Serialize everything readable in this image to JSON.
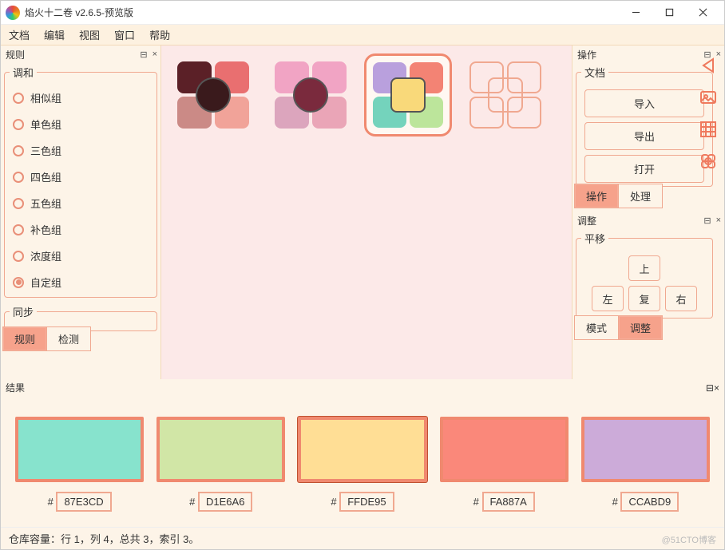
{
  "window": {
    "title": "焰火十二卷 v2.6.5-预览版"
  },
  "menu": [
    "文档",
    "编辑",
    "视图",
    "窗口",
    "帮助"
  ],
  "rules_panel": {
    "title": "规则",
    "group_label": "调和",
    "items": [
      "相似组",
      "单色组",
      "三色组",
      "四色组",
      "五色组",
      "补色组",
      "浓度组",
      "自定组"
    ],
    "selected_index": 7,
    "sync_label": "同步",
    "tabs": {
      "items": [
        "规则",
        "检测"
      ],
      "active": 0
    }
  },
  "palettes": {
    "selected_index": 2,
    "items": [
      {
        "colors": [
          "#5b2027",
          "#e96f70",
          "#cb8a86",
          "#f1a399"
        ],
        "center": "#3a1a1c",
        "center_round": true
      },
      {
        "colors": [
          "#f1a4c4",
          "#f1a4c4",
          "#dca5bd",
          "#eaa5b7"
        ],
        "center": "#7a2a3d",
        "center_round": true
      },
      {
        "colors": [
          "#b9a0dd",
          "#f38374",
          "#74d3bc",
          "#bce59b"
        ],
        "center": "#f9d97a",
        "center_round": false
      },
      {
        "outline": true
      }
    ]
  },
  "ops_panel": {
    "title": "操作",
    "group_label": "文档",
    "buttons": [
      "导入",
      "导出",
      "打开"
    ],
    "tabs": {
      "items": [
        "操作",
        "处理"
      ],
      "active": 0
    }
  },
  "adjust_panel": {
    "title": "调整",
    "group_label": "平移",
    "buttons": {
      "up": "上",
      "left": "左",
      "reset": "复",
      "right": "右"
    },
    "tabs": {
      "items": [
        "模式",
        "调整"
      ],
      "active": 1
    }
  },
  "results": {
    "title": "结果",
    "selected_index": 2,
    "items": [
      {
        "color": "#87e3cd",
        "hex": "87E3CD"
      },
      {
        "color": "#d1e6a6",
        "hex": "D1E6A6"
      },
      {
        "color": "#ffde95",
        "hex": "FFDE95"
      },
      {
        "color": "#fa887a",
        "hex": "FA887A"
      },
      {
        "color": "#ccabd9",
        "hex": "CCABD9"
      }
    ],
    "hash": "#"
  },
  "status": "仓库容量：行 1，列 4，总共 3，索引 3。",
  "watermark": "@51CTO博客"
}
